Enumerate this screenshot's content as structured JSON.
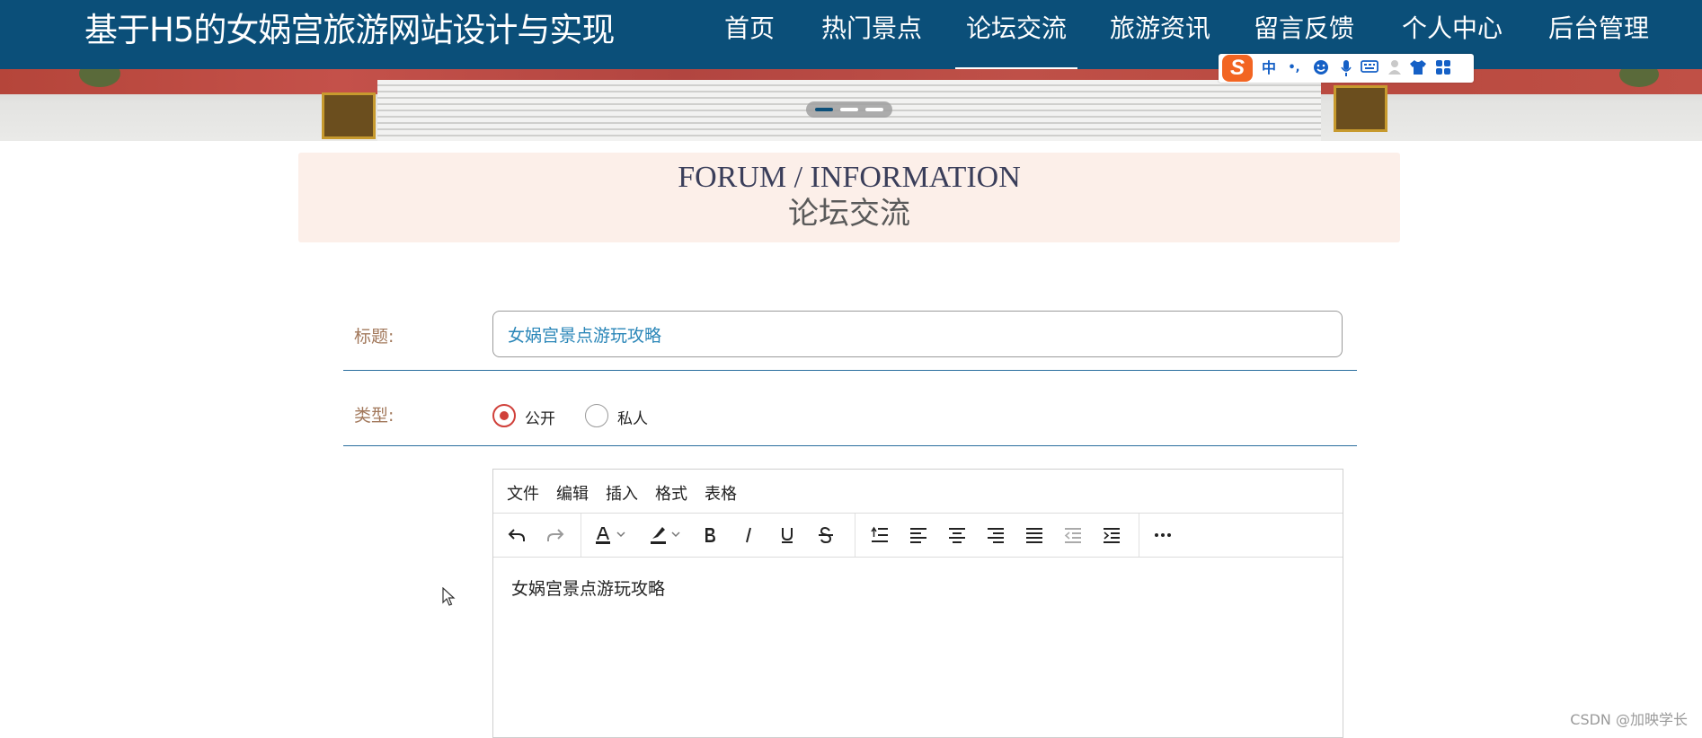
{
  "header": {
    "site_title": "基于H5的女娲宫旅游网站设计与实现",
    "nav": [
      "首页",
      "热门景点",
      "论坛交流",
      "旅游资讯",
      "留言反馈",
      "个人中心",
      "后台管理"
    ],
    "active_nav": "论坛交流"
  },
  "banner": {
    "slide_count": 3,
    "active_slide": 1
  },
  "ime_toolbar": {
    "logo": "S",
    "mode": "中",
    "punct": "•,",
    "icons": [
      "emoji-icon",
      "microphone-icon",
      "keyboard-icon",
      "user-icon",
      "shirt-icon",
      "apps-icon"
    ]
  },
  "section": {
    "title_en": "FORUM / INFORMATION",
    "title_cn": "论坛交流"
  },
  "form": {
    "title_label": "标题:",
    "title_value": "女娲宫景点游玩攻略",
    "type_label": "类型:",
    "type_options": [
      "公开",
      "私人"
    ],
    "type_selected": "公开"
  },
  "editor": {
    "menu": [
      "文件",
      "编辑",
      "插入",
      "格式",
      "表格"
    ],
    "toolbar_icons": [
      "undo-icon",
      "redo-icon",
      "text-color-icon",
      "highlight-icon",
      "bold-icon",
      "italic-icon",
      "underline-icon",
      "strikethrough-icon",
      "line-height-icon",
      "align-left-icon",
      "align-center-icon",
      "align-right-icon",
      "justify-icon",
      "outdent-icon",
      "indent-icon",
      "more-icon"
    ],
    "content": "女娲宫景点游玩攻略"
  },
  "watermark": "CSDN @加映学长",
  "colors": {
    "header_bg": "#0b4f79",
    "section_bg": "#fcefe9",
    "label": "#a2785b",
    "input_text": "#2a86b8",
    "radio_checked": "#d0403a"
  }
}
